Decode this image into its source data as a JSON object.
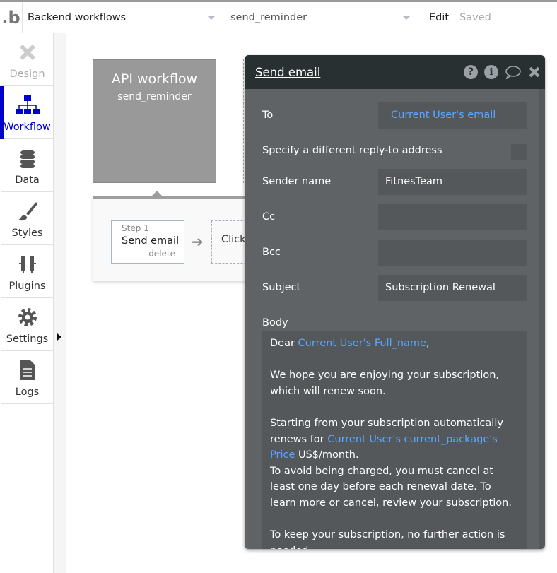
{
  "topbar": {
    "logo": ".b",
    "page_select": "Backend workflows",
    "workflow_select": "send_reminder",
    "edit": "Edit",
    "status": "Saved"
  },
  "sidebar": {
    "items": [
      {
        "label": "Design",
        "icon": "design-icon"
      },
      {
        "label": "Workflow",
        "icon": "workflow-icon"
      },
      {
        "label": "Data",
        "icon": "database-icon"
      },
      {
        "label": "Styles",
        "icon": "brush-icon"
      },
      {
        "label": "Plugins",
        "icon": "plug-icon"
      },
      {
        "label": "Settings",
        "icon": "gear-icon"
      },
      {
        "label": "Logs",
        "icon": "document-icon"
      }
    ]
  },
  "canvas": {
    "api_title": "API workflow",
    "api_name": "send_reminder",
    "step_num": "Step 1",
    "step_label": "Send email",
    "step_delete": "delete",
    "click_text": "Click"
  },
  "panel": {
    "title": "Send email",
    "to_label": "To",
    "to_value": "Current User's email",
    "replyto_label": "Specify a different reply-to address",
    "sender_label": "Sender name",
    "sender_value": "FitnesTeam",
    "cc_label": "Cc",
    "cc_value": "",
    "bcc_label": "Bcc",
    "bcc_value": "",
    "subject_label": "Subject",
    "subject_value": "Subscription Renewal",
    "body_label": "Body",
    "body": {
      "l1a": "Dear ",
      "l1b": "Current User's Full_name",
      "l1c": ",",
      "l2": "We hope you are enjoying your subscription, which will renew soon.",
      "l3a": "Starting from  your subscription automatically renews for ",
      "l3b": "Current User's current_package's Price",
      "l3c": " US$/month.",
      "l4": "To avoid being charged, you must cancel at least one day before each renewal date. To learn more or cancel, review your subscription.",
      "l5": "To keep your subscription, no further action is needed."
    }
  }
}
